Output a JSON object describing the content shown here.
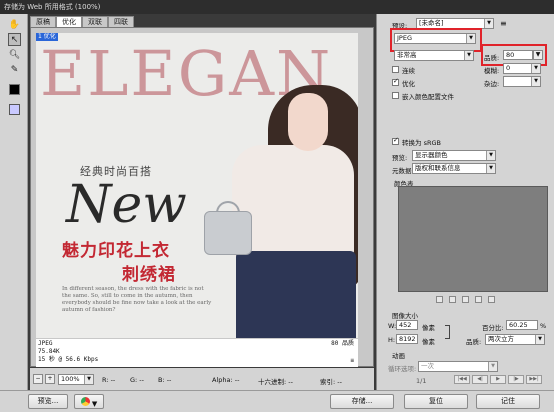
{
  "window": {
    "title": "存储为 Web 所用格式 (100%)"
  },
  "tabs": [
    "原稿",
    "优化",
    "双联",
    "四联"
  ],
  "active_tab_index": 1,
  "image": {
    "corner_label": "1 优化",
    "bg_text": "ELEGAN",
    "slogan_small": "经典时尚百搭",
    "slogan_big": "New",
    "red_line1": "魅力印花上衣",
    "red_line2": "刺绣裙",
    "paragraph": "In different season, the dress with the fabric is not the same. So, still to come in the autumn, then everybody should be fine now take a look at the early autumn of fashion?"
  },
  "info_panel": {
    "format": "JPEG",
    "size": "75.84K",
    "time": "15 秒 @ 56.6 Kbps",
    "menu_icon": "≡",
    "quality_text": "80 品质"
  },
  "statusbar": {
    "zoom": "100%",
    "r": "R:  --",
    "g": "G:  --",
    "b": "B:  --",
    "alpha": "Alpha:  --",
    "hex": "十六进制:  --",
    "index": "索引:  --"
  },
  "right": {
    "preset_label": "预设:",
    "preset_value": "[未命名]",
    "format_value": "JPEG",
    "compression_value": "非常高",
    "quality_label": "品质:",
    "quality_value": "80",
    "progressive_label": "连续",
    "blur_label": "模糊:",
    "blur_value": "0",
    "optimized_label": "优化",
    "matte_label": "杂边:",
    "embed_profile_label": "嵌入颜色配置文件",
    "convert_srgb_label": "转换为 sRGB",
    "preview_label": "预览:",
    "preview_value": "显示器颜色",
    "metadata_label": "元数据:",
    "metadata_value": "版权和联系信息",
    "color_table_label": "颜色表",
    "image_size_label": "图像大小",
    "w_label": "W:",
    "w_value": "452",
    "h_label": "H:",
    "h_value": "8192",
    "unit": "像素",
    "percent_label": "百分比:",
    "percent_value": "60.25",
    "percent_sign": "%",
    "quality2_label": "品质:",
    "quality2_value": "两次立方",
    "animation_label": "动画",
    "loop_label": "循环选项:",
    "loop_value": "一次",
    "frame_counter": "1/1"
  },
  "buttons": {
    "preview": "预览...",
    "save": "存储...",
    "reset": "复位",
    "remember": "记住"
  }
}
